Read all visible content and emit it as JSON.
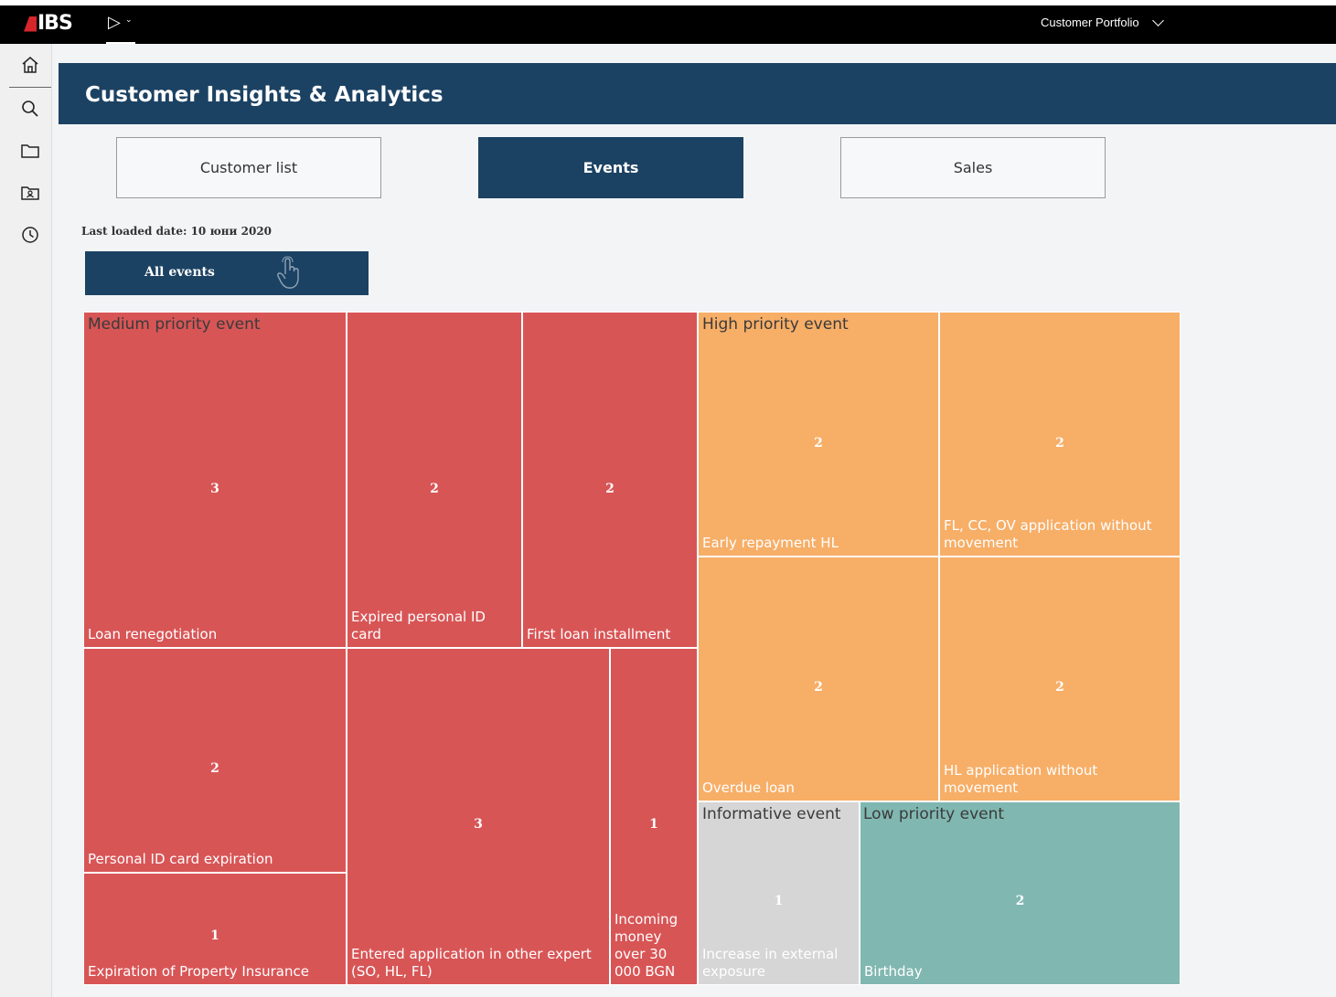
{
  "topbar": {
    "logo_text": "IBS",
    "portfolio_label": "Customer Portfolio",
    "brand_color": "#d6262c"
  },
  "leftbar": {
    "icons": [
      "home-icon",
      "search-icon",
      "folder-icon",
      "user-folder-icon",
      "history-icon"
    ]
  },
  "header": {
    "title": "Customer Insights & Analytics"
  },
  "tabs": [
    {
      "label": "Customer list",
      "active": false
    },
    {
      "label": "Events",
      "active": true
    },
    {
      "label": "Sales",
      "active": false
    }
  ],
  "last_loaded": "Last loaded date: 10 юни 2020",
  "filter_button": {
    "label": "All events"
  },
  "treemap": {
    "groups": {
      "medium": "Medium priority event",
      "high": "High priority event",
      "informative": "Informative event",
      "low": "Low priority event"
    },
    "cells": [
      {
        "label": "Loan renegotiation",
        "value": "3"
      },
      {
        "label": "Expired personal ID card",
        "value": "2"
      },
      {
        "label": "First loan installment",
        "value": "2"
      },
      {
        "label": "Personal ID card expiration",
        "value": "2"
      },
      {
        "label": "Expiration of Property Insurance",
        "value": "1"
      },
      {
        "label": "Entered application in other expert (SO, HL, FL)",
        "value": "3"
      },
      {
        "label": "Incoming money over 30 000 BGN",
        "value": "1"
      },
      {
        "label": "Early repayment HL",
        "value": "2"
      },
      {
        "label": "FL, CC, OV application without movement",
        "value": "2"
      },
      {
        "label": "Overdue loan",
        "value": "2"
      },
      {
        "label": "HL application without movement",
        "value": "2"
      },
      {
        "label": "Increase in external exposure",
        "value": "1"
      },
      {
        "label": "Birthday",
        "value": "2"
      }
    ],
    "colors": {
      "medium": "#d85556",
      "high": "#f7ae67",
      "informative": "#d6d6d6",
      "low": "#80b7b1"
    }
  }
}
